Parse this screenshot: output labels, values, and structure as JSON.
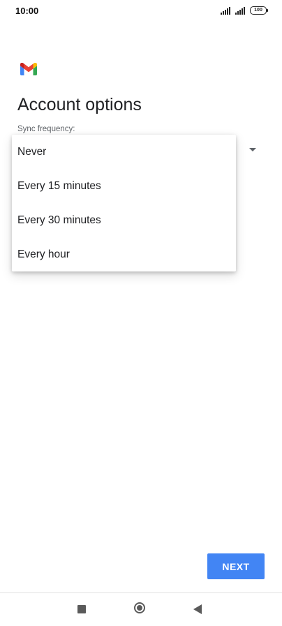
{
  "status_bar": {
    "time": "10:00",
    "battery": "100",
    "icons": [
      "signal-icon",
      "signal-icon",
      "battery-icon"
    ]
  },
  "app": {
    "logo_icon": "gmail-logo-icon"
  },
  "page": {
    "title": "Account options",
    "field_label": "Sync frequency:"
  },
  "menu": {
    "items": [
      {
        "label": "Never"
      },
      {
        "label": "Every 15 minutes"
      },
      {
        "label": "Every 30 minutes"
      },
      {
        "label": "Every hour"
      }
    ]
  },
  "actions": {
    "next_label": "NEXT"
  },
  "nav_bar": {
    "icons": [
      "recent-apps-icon",
      "home-icon",
      "back-icon"
    ]
  },
  "colors": {
    "accent": "#4285f4",
    "text_primary": "#202124",
    "text_secondary": "#5f6368",
    "gmail_red": "#ea4335",
    "gmail_blue": "#4285f4",
    "gmail_green": "#34a853",
    "gmail_yellow": "#fbbc04",
    "gmail_dark_red": "#c5221f"
  }
}
